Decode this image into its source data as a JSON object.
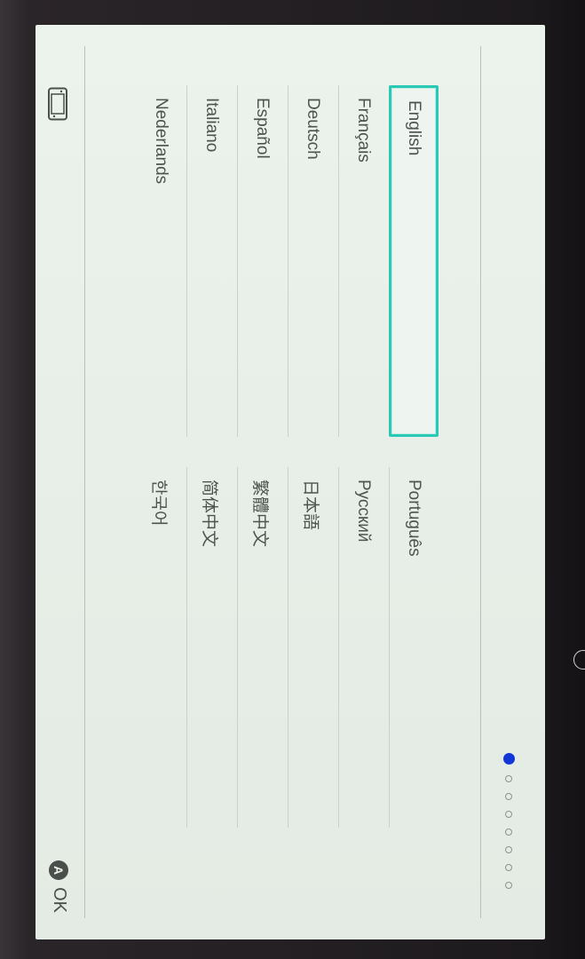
{
  "languages": {
    "left": [
      "English",
      "Français",
      "Deutsch",
      "Español",
      "Italiano",
      "Nederlands"
    ],
    "right": [
      "Português",
      "Русский",
      "日本語",
      "繁體中文",
      "简体中文",
      "한국어"
    ],
    "selected": "English"
  },
  "pagination": {
    "total": 8,
    "current": 1
  },
  "footer": {
    "device_icon": "switch-console-icon",
    "confirm_button_glyph": "A",
    "confirm_label": "OK"
  },
  "colors": {
    "screen_bg": "#e7eee7",
    "selection_border": "#29c9b5",
    "active_dot": "#1235d8",
    "text": "#4d534e"
  }
}
